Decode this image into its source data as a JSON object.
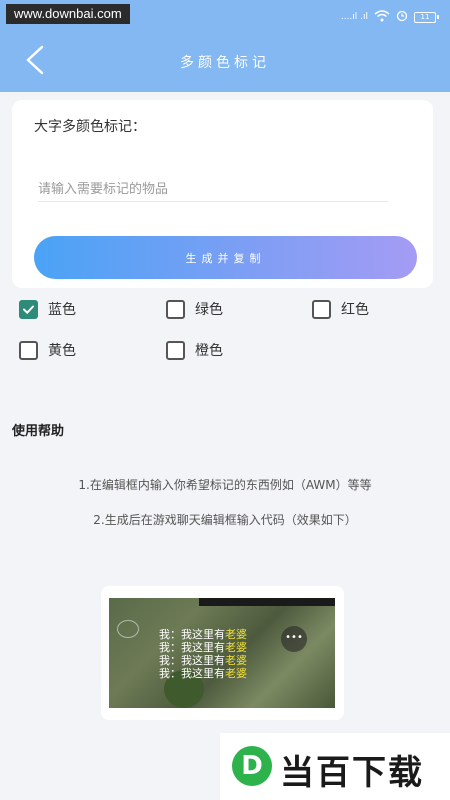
{
  "status_bar": {
    "watermark": "www.downbai.com",
    "signal": "....ıl .ıl",
    "battery": "11"
  },
  "header": {
    "title": "多颜色标记",
    "back_icon": "chevron-left-icon"
  },
  "form": {
    "label": "大字多颜色标记：",
    "input_placeholder": "请输入需要标记的物品",
    "input_value": "",
    "generate_button": "生成并复制"
  },
  "colors": [
    {
      "label": "蓝色",
      "checked": true
    },
    {
      "label": "绿色",
      "checked": false
    },
    {
      "label": "红色",
      "checked": false
    },
    {
      "label": "黄色",
      "checked": false
    },
    {
      "label": "橙色",
      "checked": false
    }
  ],
  "help": {
    "title": "使用帮助",
    "lines": [
      "1.在编辑框内输入你希望标记的东西例如（AWM）等等",
      "2.生成后在游戏聊天编辑框输入代码（效果如下）"
    ]
  },
  "preview": {
    "chat_lines": [
      {
        "prefix": "我：我这里有",
        "highlight": "老婆"
      },
      {
        "prefix": "我：我这里有",
        "highlight": "老婆"
      },
      {
        "prefix": "我：我这里有",
        "highlight": "老婆"
      },
      {
        "prefix": "我：我这里有",
        "highlight": "老婆"
      }
    ]
  },
  "brand": {
    "logo_letter": "D",
    "name": "当百下载"
  },
  "theme": {
    "header_color": "#84b8f2",
    "button_gradient_start": "#4aa3f5",
    "button_gradient_end": "#a59bf4",
    "checkbox_checked_color": "#2e8b7a"
  }
}
